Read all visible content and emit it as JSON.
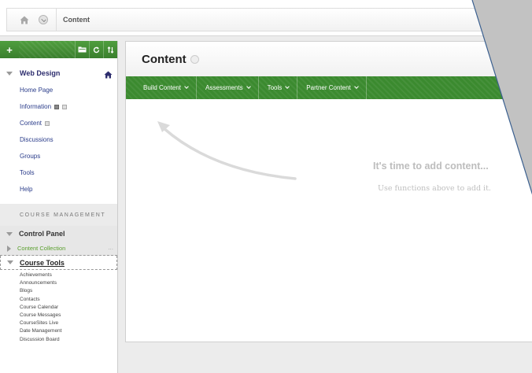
{
  "breadcrumb": {
    "home_icon": "home-icon",
    "current": "Content"
  },
  "sidebar": {
    "toolbar": {
      "add_label": "+",
      "icons": [
        "folder-icon",
        "refresh-icon",
        "sort-icon"
      ]
    },
    "course_title": "Web Design",
    "nav_items": [
      {
        "label": "Home Page"
      },
      {
        "label": "Information"
      },
      {
        "label": "Content"
      },
      {
        "label": "Discussions"
      },
      {
        "label": "Groups"
      },
      {
        "label": "Tools"
      },
      {
        "label": "Help"
      }
    ],
    "management_header": "COURSE MANAGEMENT",
    "control_panel": "Control Panel",
    "content_collection": "Content Collection",
    "content_collection_more": "...",
    "course_tools": "Course Tools",
    "course_tool_items": [
      "Achievements",
      "Announcements",
      "Blogs",
      "Contacts",
      "Course Calendar",
      "Course Messages",
      "CourseSites Live",
      "Date Management",
      "Discussion Board"
    ]
  },
  "content": {
    "title": "Content",
    "menu": [
      {
        "label": "Build Content"
      },
      {
        "label": "Assessments"
      },
      {
        "label": "Tools"
      },
      {
        "label": "Partner Content"
      }
    ],
    "empty_title": "It's time to add content...",
    "empty_subtitle": "Use functions above to add it."
  },
  "colors": {
    "accent_green": "#3b8a2f",
    "link_blue": "#2a3c8a",
    "collection_green": "#5a9f2e",
    "overlay_gray": "#c2c2c2",
    "overlay_border": "#3a5f8f"
  }
}
